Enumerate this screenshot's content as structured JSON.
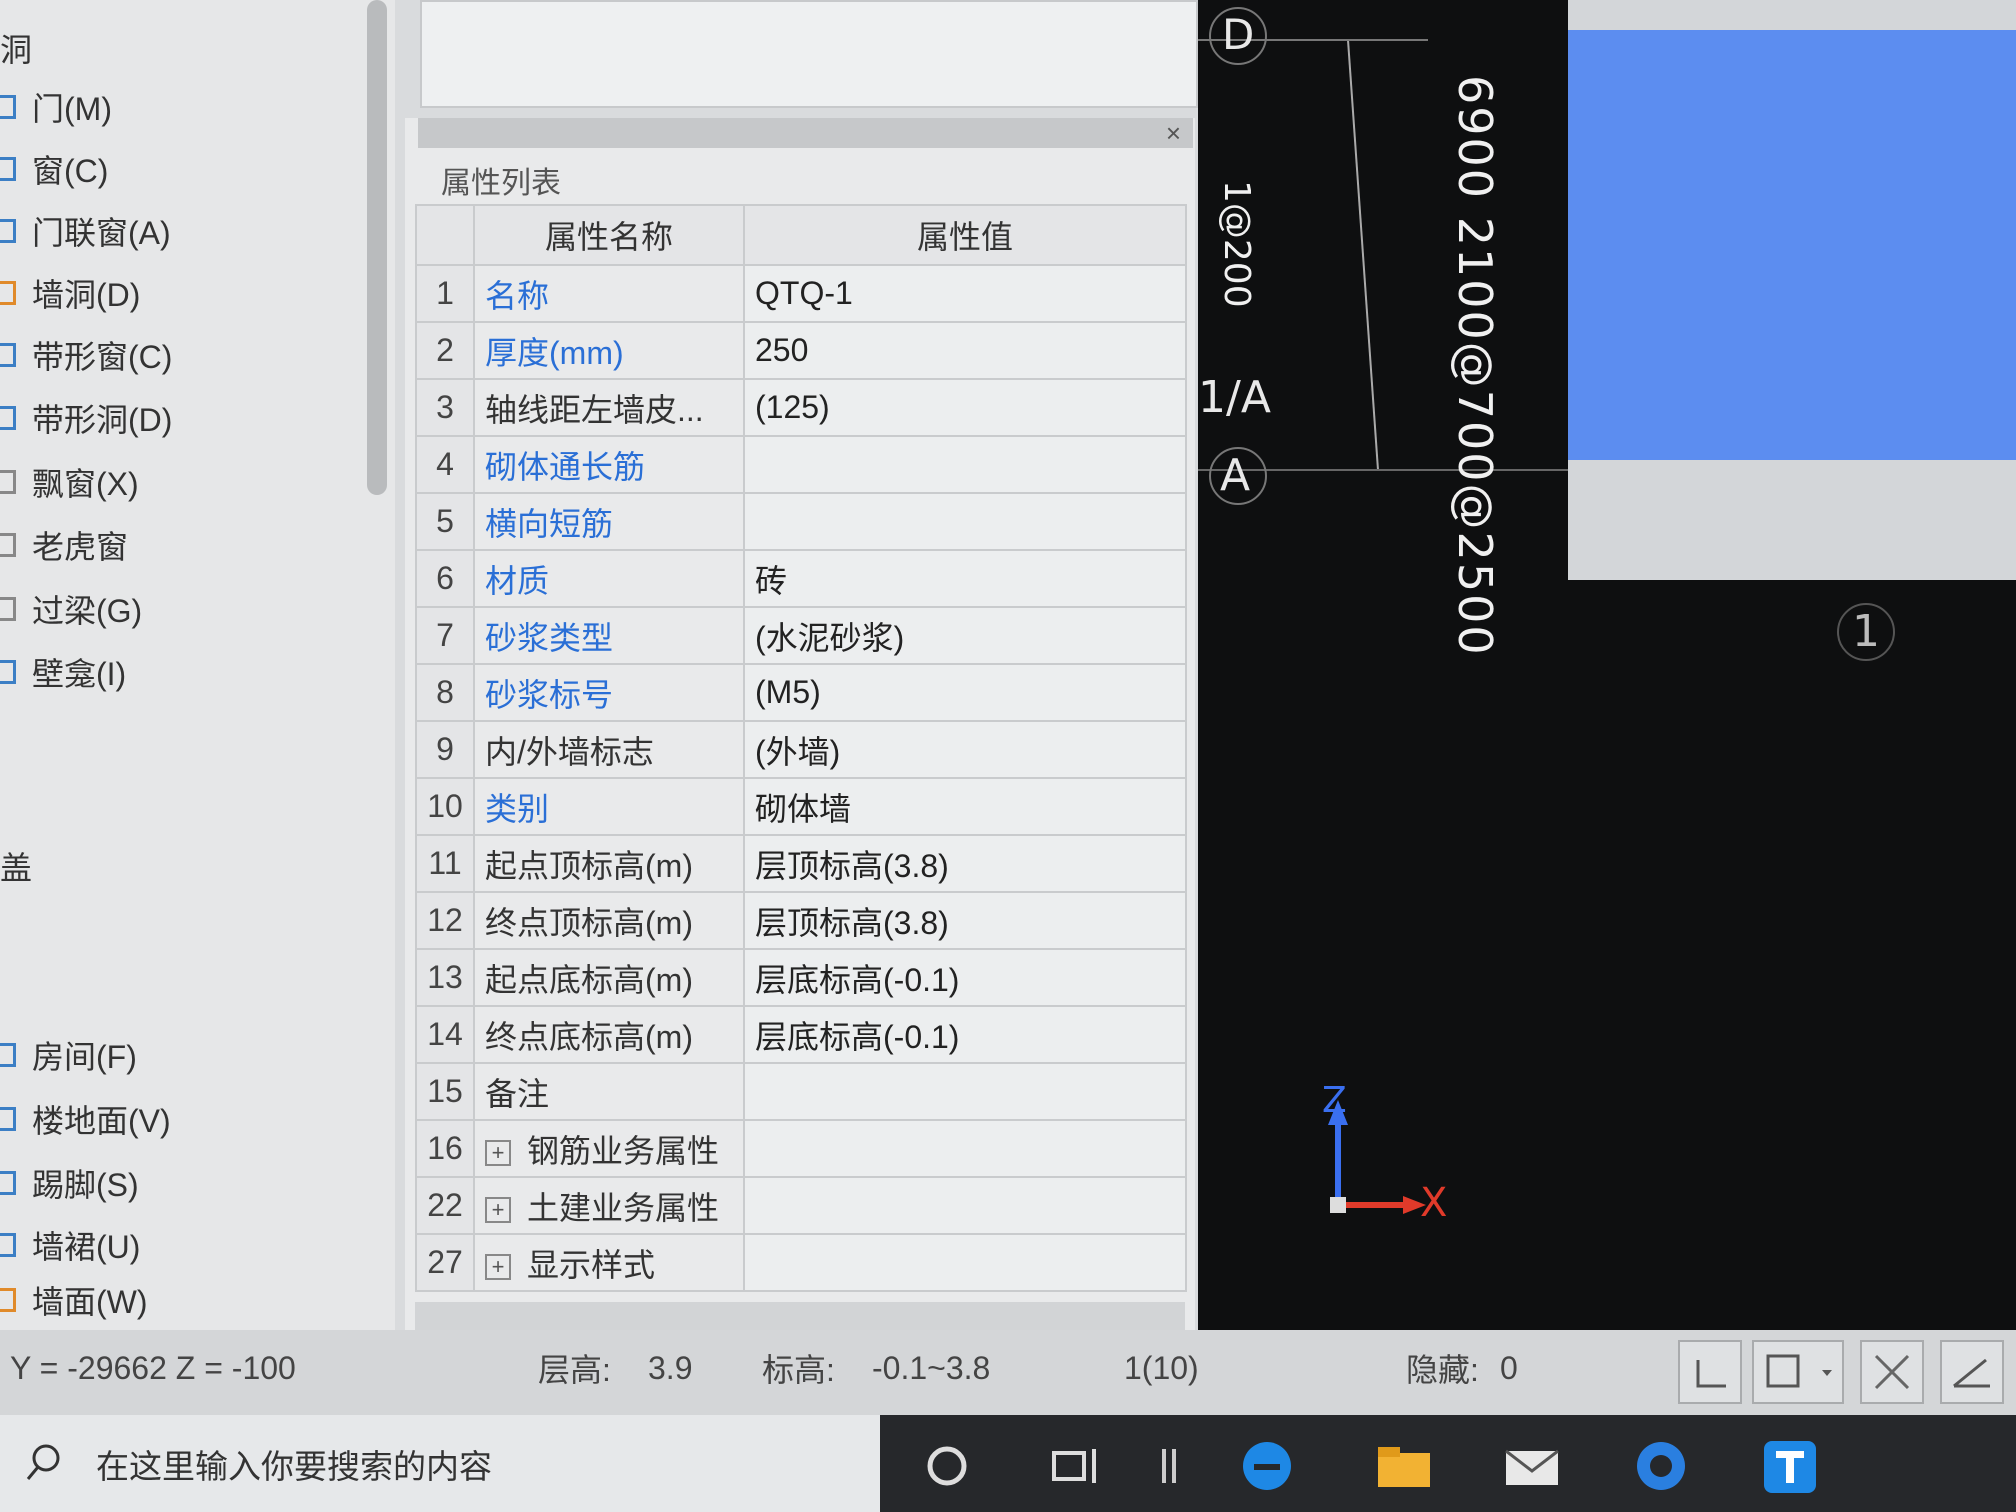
{
  "left_tree": {
    "group_top": "洞",
    "items": [
      {
        "label": "门(M)"
      },
      {
        "label": "窗(C)"
      },
      {
        "label": "门联窗(A)"
      },
      {
        "label": "墙洞(D)"
      },
      {
        "label": "带形窗(C)"
      },
      {
        "label": "带形洞(D)"
      },
      {
        "label": "飘窗(X)"
      },
      {
        "label": "老虎窗"
      },
      {
        "label": "过梁(G)"
      },
      {
        "label": "壁龛(I)"
      }
    ],
    "group_mid": "盖",
    "items2": [
      {
        "label": "房间(F)"
      },
      {
        "label": "楼地面(V)"
      },
      {
        "label": "踢脚(S)"
      },
      {
        "label": "墙裙(U)"
      },
      {
        "label": "墙面(W)"
      }
    ]
  },
  "properties": {
    "panel_title": "属性列表",
    "close_glyph": "×",
    "col_name": "属性名称",
    "col_value": "属性值",
    "rows": [
      {
        "num": "1",
        "name": "名称",
        "value": "QTQ-1",
        "blue": true
      },
      {
        "num": "2",
        "name": "厚度(mm)",
        "value": "250",
        "blue": true
      },
      {
        "num": "3",
        "name": "轴线距左墙皮...",
        "value": "(125)",
        "blue": false
      },
      {
        "num": "4",
        "name": "砌体通长筋",
        "value": "",
        "blue": true
      },
      {
        "num": "5",
        "name": "横向短筋",
        "value": "",
        "blue": true
      },
      {
        "num": "6",
        "name": "材质",
        "value": "砖",
        "blue": true
      },
      {
        "num": "7",
        "name": "砂浆类型",
        "value": "(水泥砂浆)",
        "blue": true
      },
      {
        "num": "8",
        "name": "砂浆标号",
        "value": "(M5)",
        "blue": true
      },
      {
        "num": "9",
        "name": "内/外墙标志",
        "value": "(外墙)",
        "blue": false
      },
      {
        "num": "10",
        "name": "类别",
        "value": "砌体墙",
        "blue": true
      },
      {
        "num": "11",
        "name": "起点顶标高(m)",
        "value": "层顶标高(3.8)",
        "blue": false
      },
      {
        "num": "12",
        "name": "终点顶标高(m)",
        "value": "层顶标高(3.8)",
        "blue": false
      },
      {
        "num": "13",
        "name": "起点底标高(m)",
        "value": "层底标高(-0.1)",
        "blue": false
      },
      {
        "num": "14",
        "name": "终点底标高(m)",
        "value": "层底标高(-0.1)",
        "blue": false
      },
      {
        "num": "15",
        "name": "备注",
        "value": "",
        "blue": false
      }
    ],
    "groups": [
      {
        "num": "16",
        "name": "钢筋业务属性"
      },
      {
        "num": "22",
        "name": "土建业务属性"
      },
      {
        "num": "27",
        "name": "显示样式"
      }
    ]
  },
  "cad": {
    "axis_d": "D",
    "axis_1a": "1/A",
    "axis_a": "A",
    "axis_1": "1",
    "dim_text": "6900 2100@700@2500",
    "dim_text2": "1@200",
    "axis_z": "Z",
    "axis_x": "X"
  },
  "status": {
    "coords": "Y = -29662 Z = -100",
    "floor_height_label": "层高:",
    "floor_height_value": "3.9",
    "elevation_label": "标高:",
    "elevation_value": "-0.1~3.8",
    "selection": "1(10)",
    "hidden_label": "隐藏:",
    "hidden_value": "0"
  },
  "taskbar": {
    "search_placeholder": "在这里输入你要搜索的内容"
  }
}
